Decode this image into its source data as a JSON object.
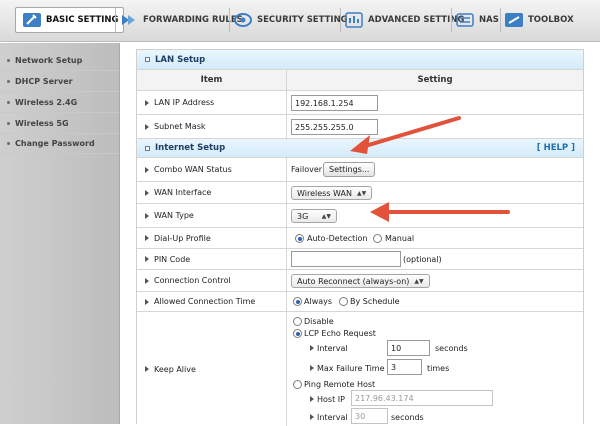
{
  "topnav": {
    "tabs": [
      {
        "label": "BASIC SETTING",
        "icon": "wrench-icon",
        "active": true
      },
      {
        "label": "FORWARDING RULES",
        "icon": "forwarding-icon",
        "active": false
      },
      {
        "label": "SECURITY SETTING",
        "icon": "shield-icon",
        "active": false
      },
      {
        "label": "ADVANCED SETTING",
        "icon": "advanced-icon",
        "active": false
      },
      {
        "label": "NAS",
        "icon": "nas-icon",
        "active": false
      },
      {
        "label": "TOOLBOX",
        "icon": "toolbox-icon",
        "active": false
      }
    ]
  },
  "sidebar": {
    "items": [
      {
        "label": "Network Setup"
      },
      {
        "label": "DHCP Server"
      },
      {
        "label": "Wireless 2.4G"
      },
      {
        "label": "Wireless 5G"
      },
      {
        "label": "Change Password"
      }
    ]
  },
  "lan": {
    "header": "LAN Setup",
    "col_item": "Item",
    "col_setting": "Setting",
    "ip_label": "LAN IP Address",
    "ip_value": "192.168.1.254",
    "mask_label": "Subnet Mask",
    "mask_value": "255.255.255.0"
  },
  "internet": {
    "header": "Internet Setup",
    "help": "[ HELP ]",
    "combo_label": "Combo WAN Status",
    "combo_status": "Failover",
    "combo_button": "Settings...",
    "wan_if_label": "WAN Interface",
    "wan_if_value": "Wireless WAN",
    "wan_type_label": "WAN Type",
    "wan_type_value": "3G",
    "dialup_label": "Dial-Up Profile",
    "dialup_auto": "Auto-Detection",
    "dialup_manual": "Manual",
    "pin_label": "PIN Code",
    "pin_value": "",
    "pin_hint": "(optional)",
    "conn_ctrl_label": "Connection Control",
    "conn_ctrl_value": "Auto Reconnect (always-on)",
    "allowed_label": "Allowed Connection Time",
    "allowed_always": "Always",
    "allowed_schedule": "By Schedule",
    "keepalive_label": "Keep Alive",
    "ka_disable": "Disable",
    "ka_lcp": "LCP Echo Request",
    "ka_interval_label": "Interval",
    "ka_interval_value": "10",
    "ka_seconds": "seconds",
    "ka_maxfail_label": "Max Failure Time",
    "ka_maxfail_value": "3",
    "ka_times": "times",
    "ka_ping": "Ping Remote Host",
    "ka_host_label": "Host IP",
    "ka_host_value": "217.96.43.174",
    "ka_ping_interval_label": "Interval",
    "ka_ping_interval_value": "30",
    "ka_ping_seconds": "seconds"
  },
  "colors": {
    "annotation_arrow": "#e2523a",
    "section_header": "#d3ebf9",
    "help_link": "#1f6fb3"
  }
}
